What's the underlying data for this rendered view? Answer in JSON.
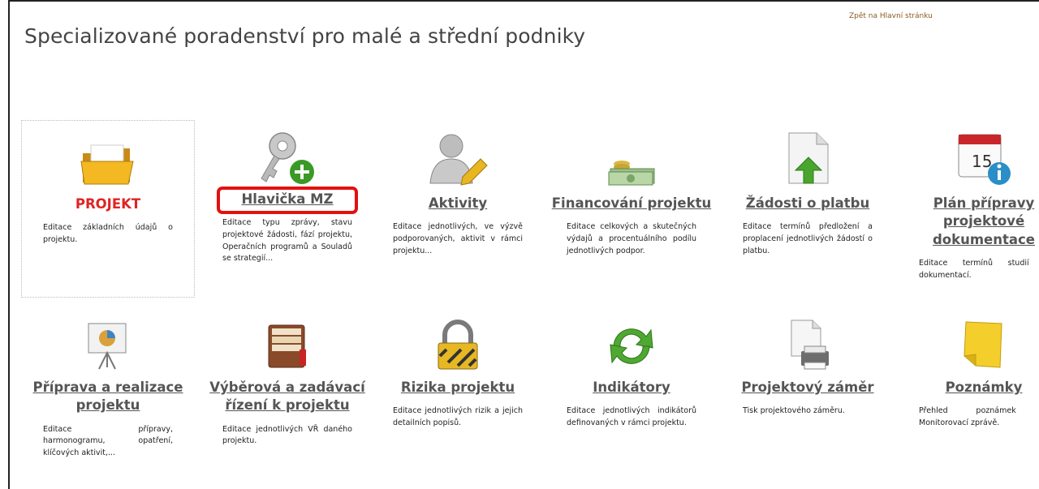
{
  "header": {
    "title": "Specializované poradenství pro malé a střední podniky",
    "back_link": "Zpět na Hlavní stránku"
  },
  "tiles": [
    {
      "title": "PROJEKT",
      "desc": "Editace základních údajů o projektu.",
      "icon": "folder-icon"
    },
    {
      "title": "Hlavička MZ",
      "desc": "Editace typu zprávy, stavu projektové žádosti, fází projektu, Operačních programů a Souladů se strategií...",
      "icon": "key-add-icon"
    },
    {
      "title": "Aktivity",
      "desc": "Editace jednotlivých, ve výzvě podporovaných, aktivit v rámci projektu...",
      "icon": "user-edit-icon"
    },
    {
      "title": "Financování projektu",
      "desc": "Editace celkových a skutečných výdajů a procentuálního podílu jednotlivých podpor.",
      "icon": "money-icon"
    },
    {
      "title": "Žádosti o platbu",
      "desc": "Editace termínů předložení a proplacení jednotlivých žádostí o platbu.",
      "icon": "document-upload-icon"
    },
    {
      "title": "Plán přípravy projektové dokumentace",
      "desc": "Editace termínů studií a dokumentací.",
      "icon": "calendar-info-icon",
      "calendar_day": "15"
    },
    {
      "title": "Příprava a realizace projektu",
      "desc": "Editace přípravy, harmonogramu, opatření, klíčových aktivit,...",
      "icon": "presentation-icon"
    },
    {
      "title": "Výběrová a zadávací řízení k projektu",
      "desc": "Editace jednotlivých VŘ daného projektu.",
      "icon": "file-box-icon"
    },
    {
      "title": "Rizika projektu",
      "desc": "Editace jednotlivých rizik a jejich detailních popisů.",
      "icon": "lock-icon"
    },
    {
      "title": "Indikátory",
      "desc": "Editace jednotlivých indikátorů definovaných v rámci projektu.",
      "icon": "refresh-icon"
    },
    {
      "title": "Projektový záměr",
      "desc": "Tisk projektového záměru.",
      "icon": "print-icon"
    },
    {
      "title": "Poznámky",
      "desc": "Přehled poznámek k Monitorovací zprávě.",
      "icon": "note-icon"
    }
  ],
  "colors": {
    "title_red": "#e02323",
    "highlight": "#e31010",
    "link_brown": "#8a5a22"
  }
}
